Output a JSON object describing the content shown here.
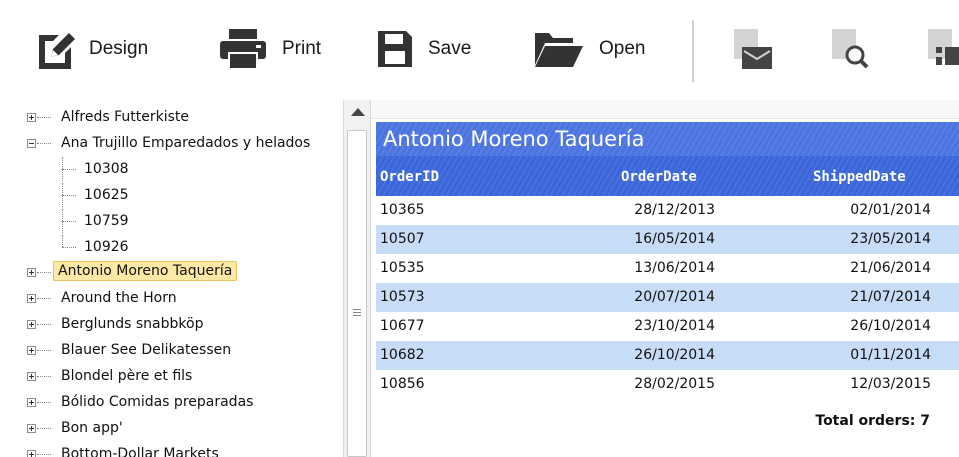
{
  "toolbar": {
    "buttons": [
      {
        "label": "Design",
        "icon": "design-icon"
      },
      {
        "label": "Print",
        "icon": "printer-icon"
      },
      {
        "label": "Save",
        "icon": "floppy-disk-icon"
      },
      {
        "label": "Open",
        "icon": "folder-open-icon"
      }
    ],
    "icon_buttons": [
      "email-icon",
      "preview-search-icon",
      "report-layout-icon"
    ]
  },
  "tree": {
    "items": [
      {
        "label": "Alfreds Futterkiste",
        "expanded": false
      },
      {
        "label": "Ana Trujillo Emparedados y helados",
        "expanded": true,
        "children": [
          "10308",
          "10625",
          "10759",
          "10926"
        ]
      },
      {
        "label": "Antonio Moreno Taquería",
        "expanded": false,
        "selected": true
      },
      {
        "label": "Around the Horn",
        "expanded": false
      },
      {
        "label": "Berglunds snabbköp",
        "expanded": false
      },
      {
        "label": "Blauer See Delikatessen",
        "expanded": false
      },
      {
        "label": "Blondel père et fils",
        "expanded": false
      },
      {
        "label": "Bólido Comidas preparadas",
        "expanded": false
      },
      {
        "label": "Bon app'",
        "expanded": false
      },
      {
        "label": "Bottom-Dollar Markets",
        "expanded": false
      }
    ]
  },
  "report": {
    "title": "Antonio Moreno Taquería",
    "columns": [
      "OrderID",
      "OrderDate",
      "ShippedDate"
    ],
    "rows": [
      [
        "10365",
        "28/12/2013",
        "02/01/2014"
      ],
      [
        "10507",
        "16/05/2014",
        "23/05/2014"
      ],
      [
        "10535",
        "13/06/2014",
        "21/06/2014"
      ],
      [
        "10573",
        "20/07/2014",
        "21/07/2014"
      ],
      [
        "10677",
        "23/10/2014",
        "26/10/2014"
      ],
      [
        "10682",
        "26/10/2014",
        "01/11/2014"
      ],
      [
        "10856",
        "28/02/2015",
        "12/03/2015"
      ]
    ],
    "total": "Total orders: 7"
  },
  "colors": {
    "header_blue": "#3a66d9",
    "title_blue": "#4b74e0",
    "row_alt": "#c7dcf7",
    "selection": "#fde9a5"
  }
}
